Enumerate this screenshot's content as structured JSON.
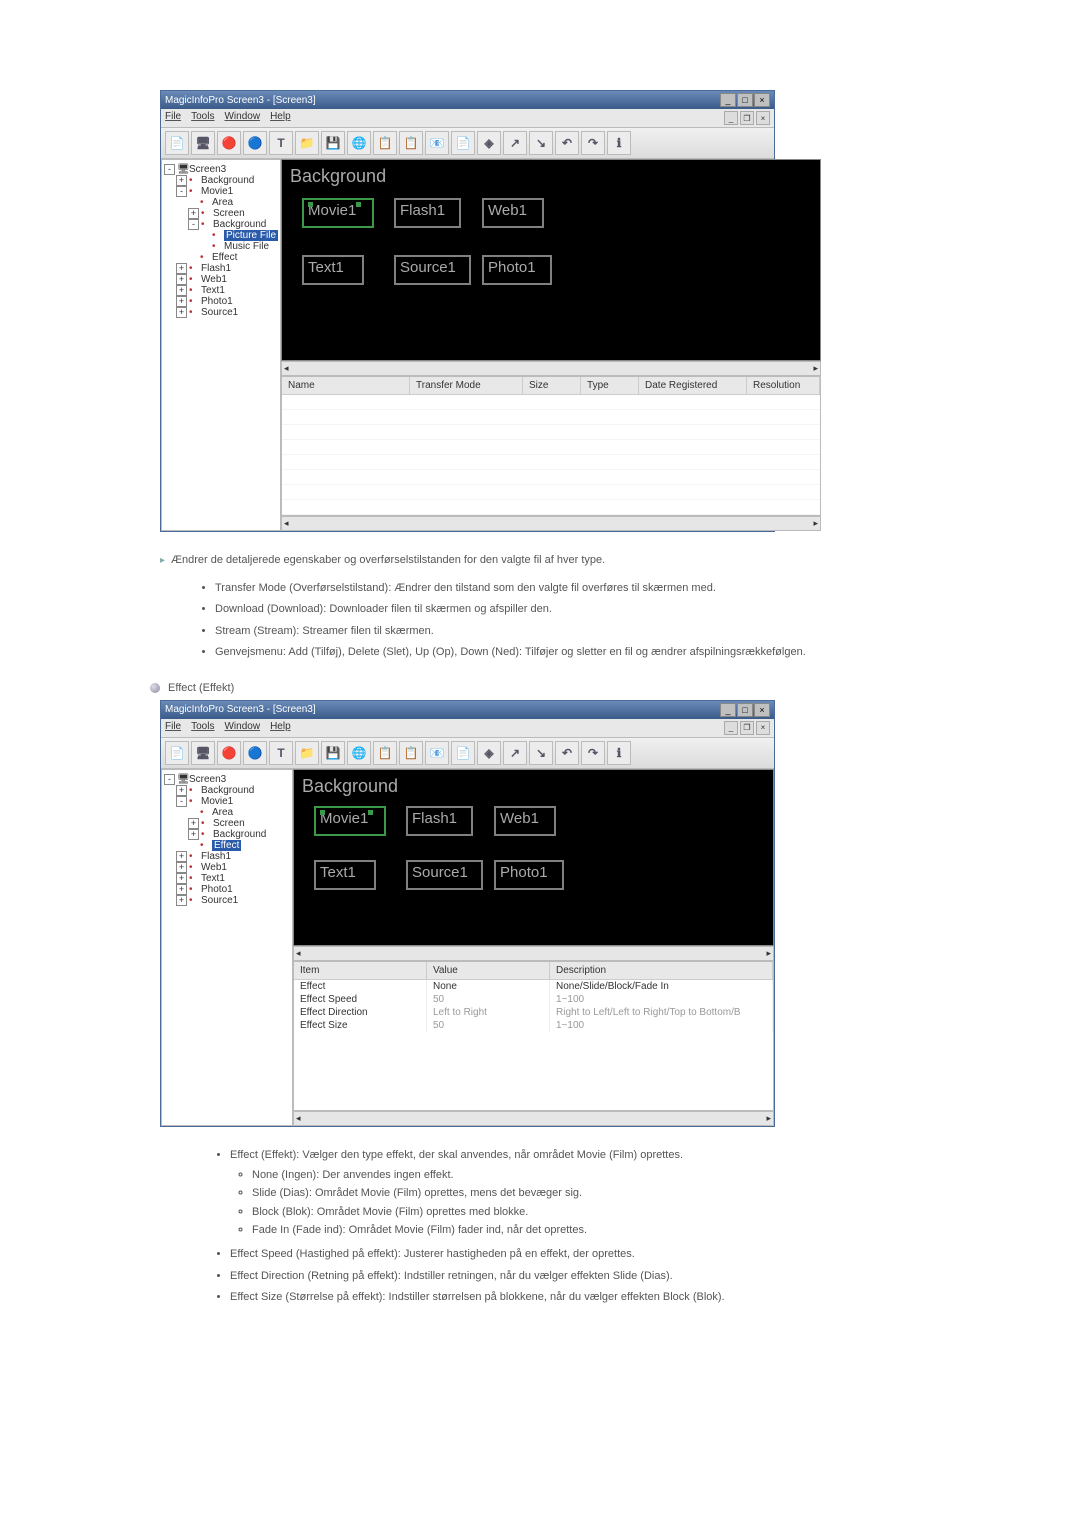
{
  "app": {
    "title": "MagicInfoPro Screen3 - [Screen3]",
    "menus": [
      "File",
      "Tools",
      "Window",
      "Help"
    ]
  },
  "toolbar_icons": [
    "📄",
    "🖥",
    "🔴",
    "🔵",
    "T",
    "📁",
    "💾",
    "🌐",
    "📋",
    "📋",
    "📧",
    "📄",
    "◈",
    "↗",
    "↘",
    "↶",
    "↷",
    "ℹ"
  ],
  "tree1": {
    "root": "Screen3",
    "items": [
      {
        "lvl": 1,
        "exp": "+",
        "label": "Background"
      },
      {
        "lvl": 1,
        "exp": "-",
        "label": "Movie1"
      },
      {
        "lvl": 2,
        "exp": "",
        "label": "Area"
      },
      {
        "lvl": 2,
        "exp": "+",
        "label": "Screen"
      },
      {
        "lvl": 2,
        "exp": "-",
        "label": "Background"
      },
      {
        "lvl": 3,
        "exp": "",
        "label": "Picture File",
        "sel": true
      },
      {
        "lvl": 3,
        "exp": "",
        "label": "Music File"
      },
      {
        "lvl": 2,
        "exp": "",
        "label": "Effect"
      },
      {
        "lvl": 1,
        "exp": "+",
        "label": "Flash1"
      },
      {
        "lvl": 1,
        "exp": "+",
        "label": "Web1"
      },
      {
        "lvl": 1,
        "exp": "+",
        "label": "Text1"
      },
      {
        "lvl": 1,
        "exp": "+",
        "label": "Photo1"
      },
      {
        "lvl": 1,
        "exp": "+",
        "label": "Source1"
      }
    ]
  },
  "tree2": {
    "root": "Screen3",
    "items": [
      {
        "lvl": 1,
        "exp": "+",
        "label": "Background"
      },
      {
        "lvl": 1,
        "exp": "-",
        "label": "Movie1"
      },
      {
        "lvl": 2,
        "exp": "",
        "label": "Area"
      },
      {
        "lvl": 2,
        "exp": "+",
        "label": "Screen"
      },
      {
        "lvl": 2,
        "exp": "+",
        "label": "Background"
      },
      {
        "lvl": 2,
        "exp": "",
        "label": "Effect",
        "sel": true
      },
      {
        "lvl": 1,
        "exp": "+",
        "label": "Flash1"
      },
      {
        "lvl": 1,
        "exp": "+",
        "label": "Web1"
      },
      {
        "lvl": 1,
        "exp": "+",
        "label": "Text1"
      },
      {
        "lvl": 1,
        "exp": "+",
        "label": "Photo1"
      },
      {
        "lvl": 1,
        "exp": "+",
        "label": "Source1"
      }
    ]
  },
  "canvas": {
    "bg": "Background",
    "slots": [
      "Movie1",
      "Flash1",
      "Web1",
      "Text1",
      "Source1",
      "Photo1"
    ]
  },
  "grid1": {
    "headers": [
      "Name",
      "Transfer Mode",
      "Size",
      "Type",
      "Date Registered",
      "Resolution"
    ]
  },
  "grid2": {
    "headers": [
      "Item",
      "Value",
      "Description"
    ],
    "rows": [
      {
        "item": "Effect",
        "value": "None",
        "desc": "None/Slide/Block/Fade In"
      },
      {
        "item": "Effect Speed",
        "value": "50",
        "desc": "1~100"
      },
      {
        "item": "Effect Direction",
        "value": "Left to Right",
        "desc": "Right to Left/Left to Right/Top to Bottom/B"
      },
      {
        "item": "Effect Size",
        "value": "50",
        "desc": "1~100"
      }
    ]
  },
  "desc1": {
    "lead": "Ændrer de detaljerede egenskaber og overførselstilstanden for den valgte fil af hver type.",
    "bullets": [
      "Transfer Mode (Overførselstilstand): Ændrer den tilstand som den valgte fil overføres til skærmen med.",
      "Download (Download): Downloader filen til skærmen og afspiller den.",
      "Stream (Stream): Streamer filen til skærmen.",
      "Genvejsmenu: Add (Tilføj), Delete (Slet), Up (Op), Down (Ned): Tilføjer og sletter en fil og ændrer afspilningsrækkefølgen."
    ]
  },
  "section2_title": "Effect (Effekt)",
  "desc2": {
    "head": "Effect (Effekt): Vælger den type effekt, der skal anvendes, når området Movie (Film) oprettes.",
    "sub": [
      "None (Ingen): Der anvendes ingen effekt.",
      "Slide (Dias): Området Movie (Film) oprettes, mens det bevæger sig.",
      "Block (Blok): Området Movie (Film) oprettes med blokke.",
      "Fade In (Fade ind): Området Movie (Film) fader ind, når det oprettes."
    ],
    "rest": [
      "Effect Speed (Hastighed på effekt): Justerer hastigheden på en effekt, der oprettes.",
      "Effect Direction (Retning på effekt): Indstiller retningen, når du vælger effekten Slide (Dias).",
      "Effect Size (Størrelse på effekt): Indstiller størrelsen på blokkene, når du vælger effekten Block (Blok)."
    ]
  }
}
